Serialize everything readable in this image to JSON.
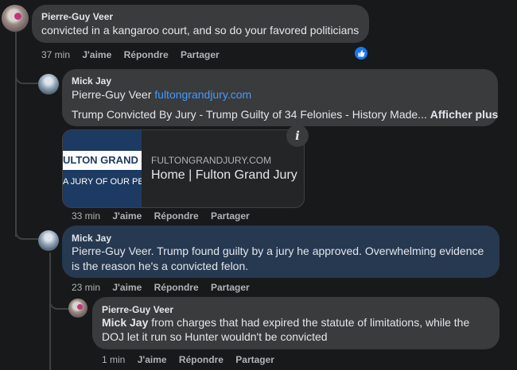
{
  "comments": [
    {
      "author": "Pierre-Guy Veer",
      "text": "convicted in a kangaroo court, and so do your favored politicians",
      "time": "37 min",
      "like": "J'aime",
      "reply": "Répondre",
      "share": "Partager"
    },
    {
      "author": "Mick Jay",
      "mention": "Pierre-Guy Veer",
      "link": "fultongrandjury.com",
      "preview_text": "Trump Convicted By Jury - Trump Guilty of 34 Felonies - History Made...",
      "see_more": "Afficher plus",
      "card": {
        "thumb_line1": "ULTON GRAND JURY",
        "thumb_line2": "A JURY OF OUR PEERS",
        "domain": "FULTONGRANDJURY.COM",
        "title": "Home | Fulton Grand Jury",
        "info_icon": "i"
      },
      "time": "33 min",
      "like": "J'aime",
      "reply": "Répondre",
      "share": "Partager"
    },
    {
      "author": "Mick Jay",
      "text_line1": "Pierre-Guy Veer. Trump found guilty by a jury he approved. Overwhelming evidence",
      "text_line2": "is the reason he's a convicted felon.",
      "time": "23 min",
      "like": "J'aime",
      "reply": "Répondre",
      "share": "Partager"
    },
    {
      "author": "Pierre-Guy Veer",
      "mention": "Mick Jay",
      "text_line1": "from charges that had expired the statute of limitations, while the",
      "text_line2": "DOJ let it run so Hunter wouldn't be convicted",
      "time": "1 min",
      "like": "J'aime",
      "reply": "Répondre",
      "share": "Partager"
    }
  ],
  "colors": {
    "background": "#18191a",
    "bubble": "#3a3b3c",
    "highlight_bubble": "#263951",
    "link": "#4599ff",
    "like_blue": "#1877f2"
  }
}
